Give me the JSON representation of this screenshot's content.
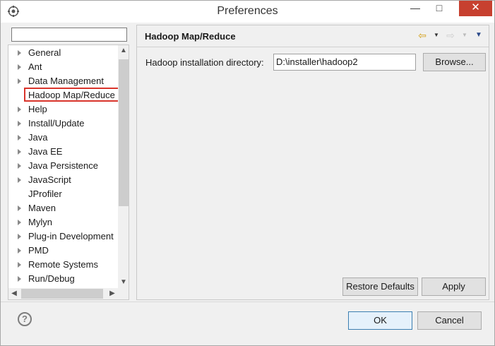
{
  "window": {
    "title": "Preferences",
    "min_glyph": "—",
    "max_glyph": "□",
    "close_glyph": "✕"
  },
  "filter": {
    "value": ""
  },
  "tree": {
    "items": [
      {
        "label": "General",
        "expandable": true
      },
      {
        "label": "Ant",
        "expandable": true
      },
      {
        "label": "Data Management",
        "expandable": true
      },
      {
        "label": "Hadoop Map/Reduce",
        "expandable": false,
        "selected": true
      },
      {
        "label": "Help",
        "expandable": true
      },
      {
        "label": "Install/Update",
        "expandable": true
      },
      {
        "label": "Java",
        "expandable": true
      },
      {
        "label": "Java EE",
        "expandable": true
      },
      {
        "label": "Java Persistence",
        "expandable": true
      },
      {
        "label": "JavaScript",
        "expandable": true
      },
      {
        "label": "JProfiler",
        "expandable": false
      },
      {
        "label": "Maven",
        "expandable": true
      },
      {
        "label": "Mylyn",
        "expandable": true
      },
      {
        "label": "Plug-in Development",
        "expandable": true
      },
      {
        "label": "PMD",
        "expandable": true
      },
      {
        "label": "Remote Systems",
        "expandable": true
      },
      {
        "label": "Run/Debug",
        "expandable": true
      }
    ]
  },
  "page": {
    "title": "Hadoop Map/Reduce",
    "field_label": "Hadoop installation directory:",
    "field_value": "D:\\installer\\hadoop2",
    "browse_label": "Browse...",
    "restore_label": "Restore Defaults",
    "apply_label": "Apply"
  },
  "footer": {
    "help_glyph": "?",
    "ok_label": "OK",
    "cancel_label": "Cancel"
  },
  "colors": {
    "selection_outline": "#d9342b",
    "close_button": "#c7402f",
    "back_arrow": "#d4a017"
  }
}
